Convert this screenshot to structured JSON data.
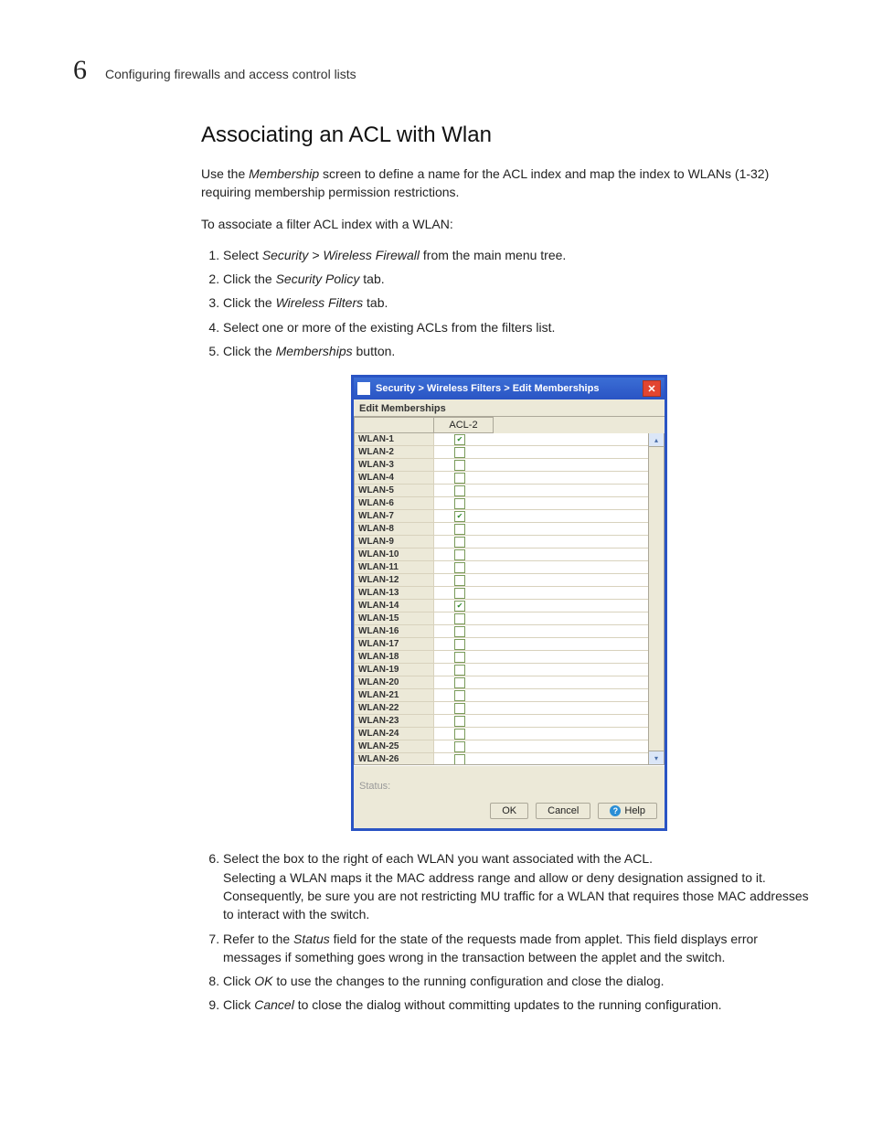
{
  "header": {
    "chapter_number": "6",
    "chapter_title": "Configuring firewalls and access control lists"
  },
  "heading": "Associating an ACL with Wlan",
  "intro_p1a": "Use the ",
  "intro_p1_em": "Membership",
  "intro_p1b": " screen to define a name for the ACL index and map the index to WLANs (1-32) requiring membership permission restrictions.",
  "intro_p2": "To associate a filter ACL index with a WLAN:",
  "steps_1_5": [
    {
      "pre": "Select ",
      "em": "Security > Wireless Firewall",
      "post": " from the main menu tree."
    },
    {
      "pre": "Click the ",
      "em": "Security Policy",
      "post": " tab."
    },
    {
      "pre": "Click the ",
      "em": "Wireless Filters",
      "post": " tab."
    },
    {
      "pre": "Select one or more of the existing ACLs from the filters list.",
      "em": "",
      "post": ""
    },
    {
      "pre": "Click the ",
      "em": "Memberships",
      "post": " button."
    }
  ],
  "dialog": {
    "title": "Security > Wireless Filters > Edit Memberships",
    "section_label": "Edit Memberships",
    "col1": "",
    "col2": "ACL-2",
    "rows": [
      {
        "name": "WLAN-1",
        "checked": true
      },
      {
        "name": "WLAN-2",
        "checked": false
      },
      {
        "name": "WLAN-3",
        "checked": false
      },
      {
        "name": "WLAN-4",
        "checked": false
      },
      {
        "name": "WLAN-5",
        "checked": false
      },
      {
        "name": "WLAN-6",
        "checked": false
      },
      {
        "name": "WLAN-7",
        "checked": true
      },
      {
        "name": "WLAN-8",
        "checked": false
      },
      {
        "name": "WLAN-9",
        "checked": false
      },
      {
        "name": "WLAN-10",
        "checked": false
      },
      {
        "name": "WLAN-11",
        "checked": false
      },
      {
        "name": "WLAN-12",
        "checked": false
      },
      {
        "name": "WLAN-13",
        "checked": false
      },
      {
        "name": "WLAN-14",
        "checked": true
      },
      {
        "name": "WLAN-15",
        "checked": false
      },
      {
        "name": "WLAN-16",
        "checked": false
      },
      {
        "name": "WLAN-17",
        "checked": false
      },
      {
        "name": "WLAN-18",
        "checked": false
      },
      {
        "name": "WLAN-19",
        "checked": false
      },
      {
        "name": "WLAN-20",
        "checked": false
      },
      {
        "name": "WLAN-21",
        "checked": false
      },
      {
        "name": "WLAN-22",
        "checked": false
      },
      {
        "name": "WLAN-23",
        "checked": false
      },
      {
        "name": "WLAN-24",
        "checked": false
      },
      {
        "name": "WLAN-25",
        "checked": false
      },
      {
        "name": "WLAN-26",
        "checked": false
      }
    ],
    "status_label": "Status:",
    "buttons": {
      "ok": "OK",
      "cancel": "Cancel",
      "help": "Help"
    }
  },
  "steps_6_9": {
    "s6a": "Select the box to the right of each WLAN you want associated with the ACL.",
    "s6b": "Selecting a WLAN maps it the MAC address range and allow or deny designation assigned to it. Consequently, be sure you are not restricting MU traffic for a WLAN that requires those MAC addresses to interact with the switch.",
    "s7_pre": "Refer to the ",
    "s7_em": "Status",
    "s7_post": " field for the state of the requests made from applet. This field displays error messages if something goes wrong in the transaction between the applet and the switch.",
    "s8_pre": "Click ",
    "s8_em": "OK",
    "s8_post": " to use the changes to the running configuration and close the dialog.",
    "s9_pre": "Click ",
    "s9_em": "Cancel",
    "s9_post": " to close the dialog without committing updates to the running configuration."
  }
}
